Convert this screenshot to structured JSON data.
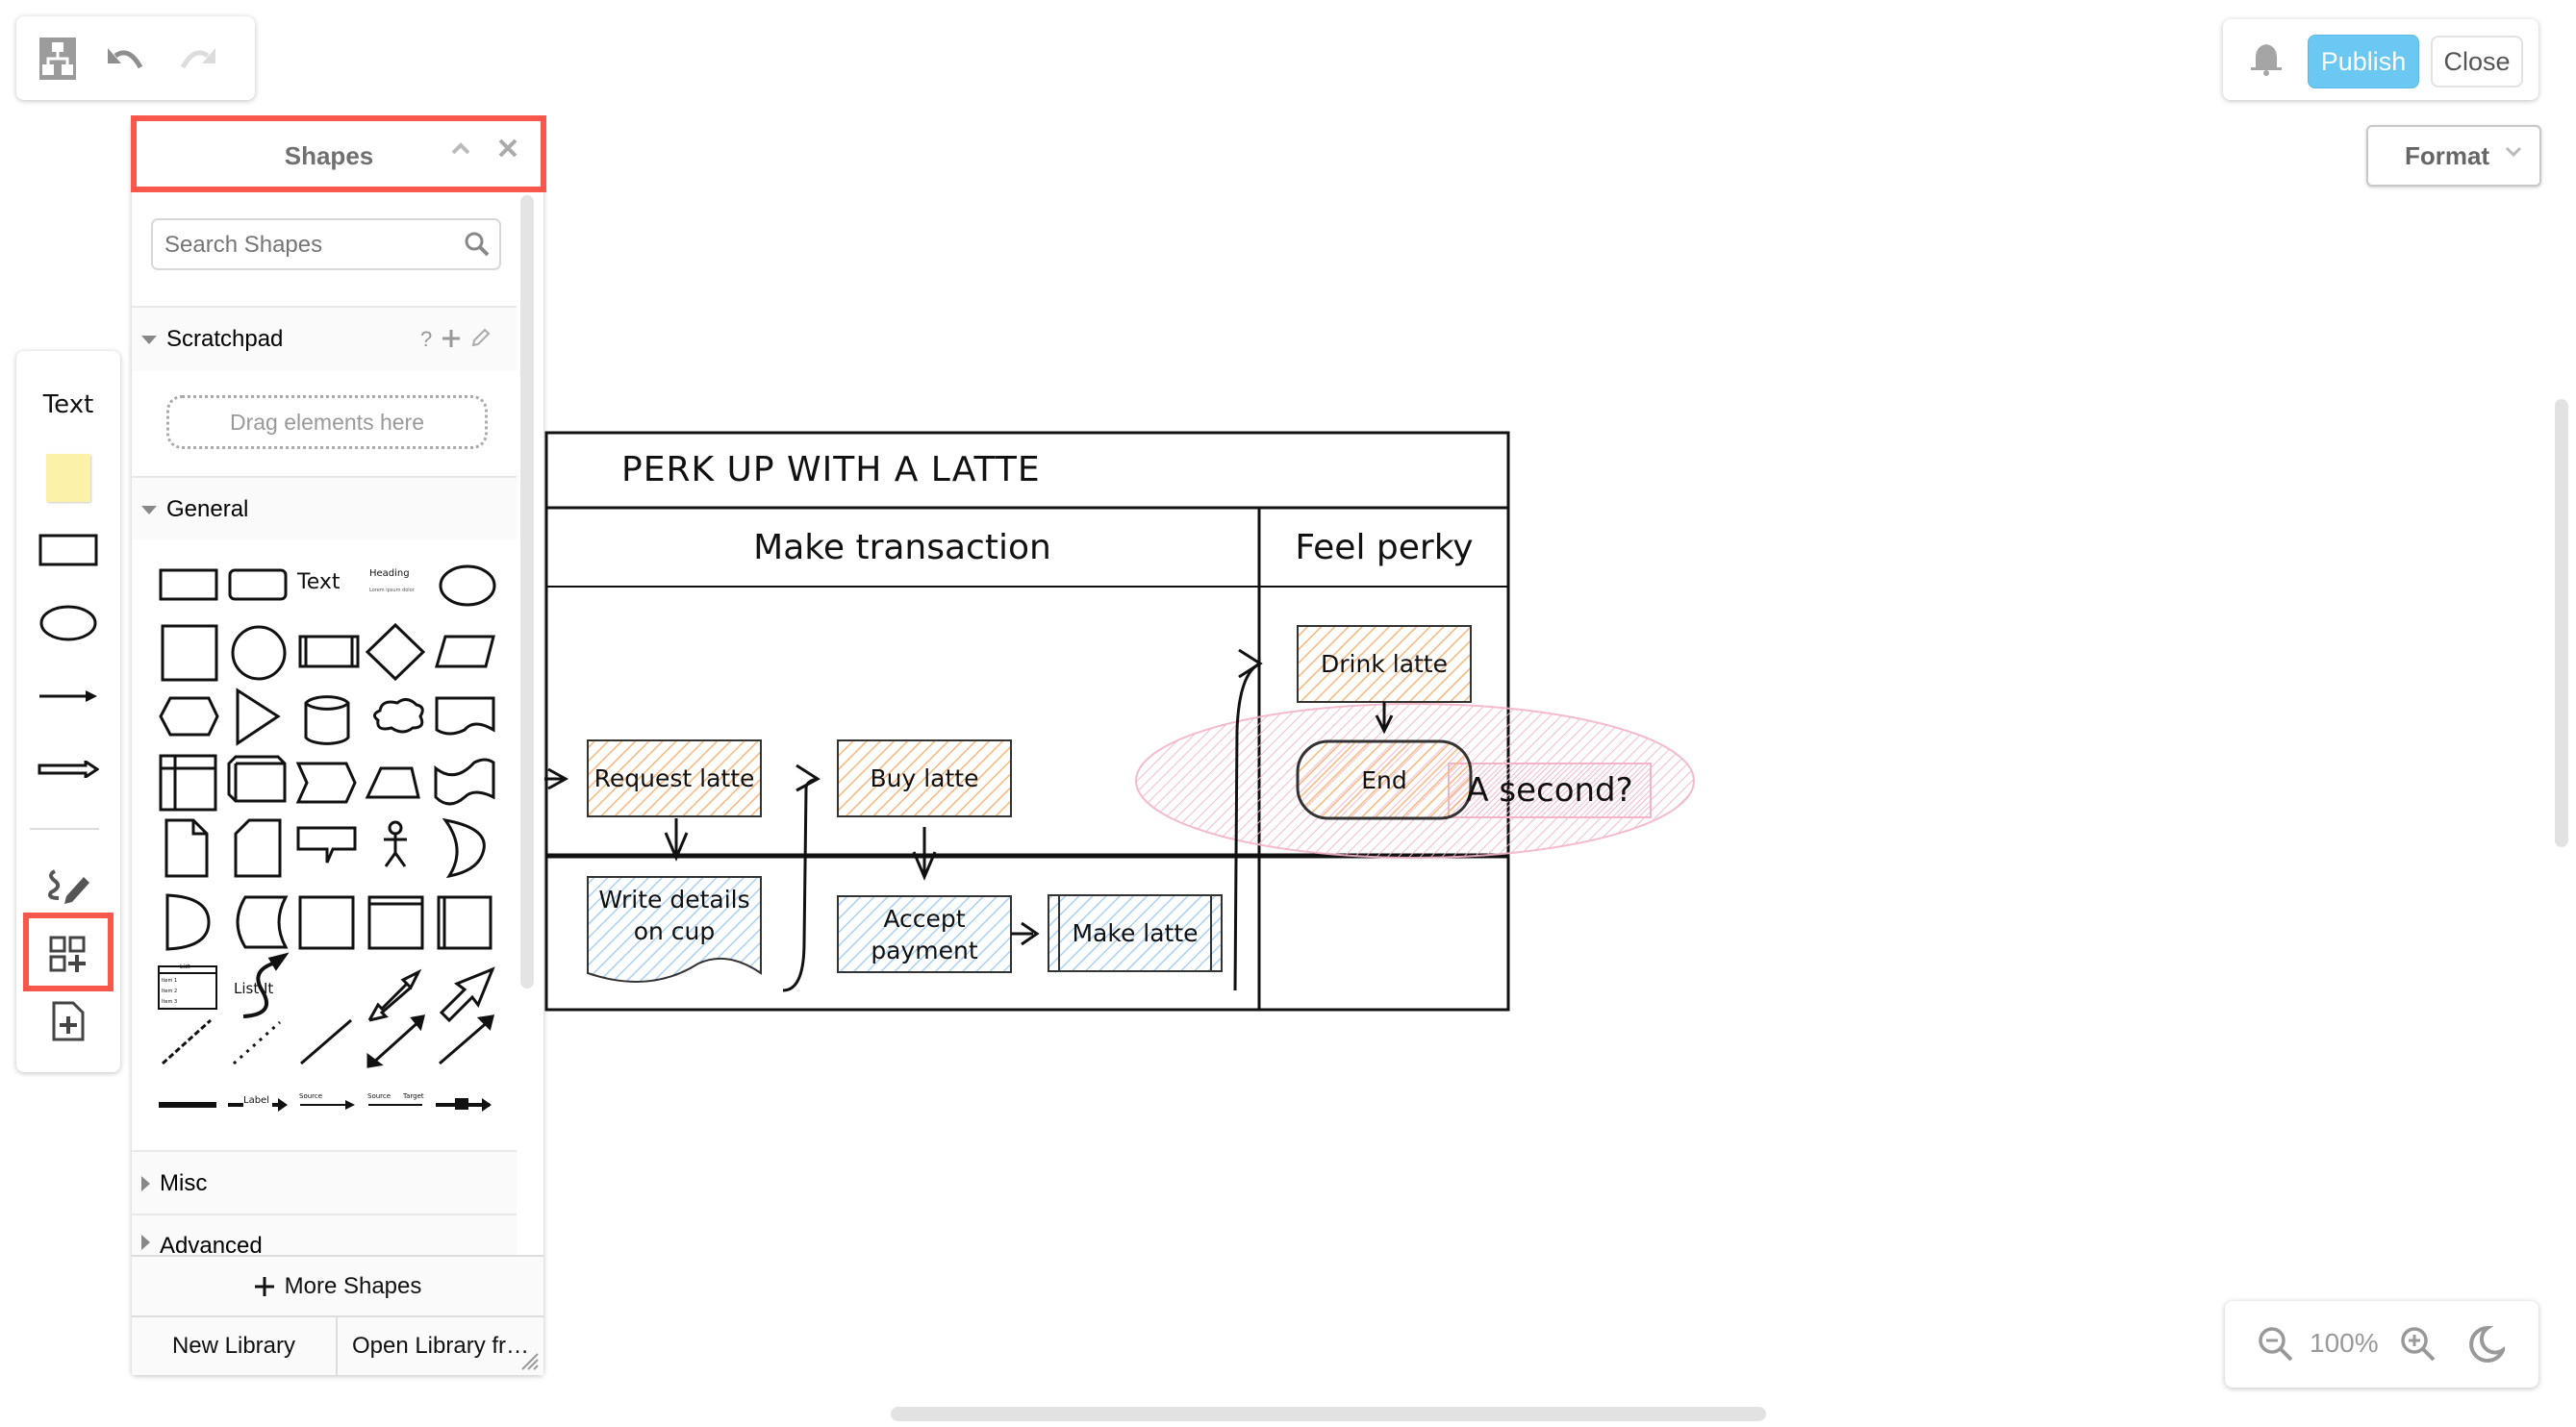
{
  "toolbar": {
    "icons": [
      "diagram-app-icon",
      "undo-icon",
      "redo-icon"
    ]
  },
  "header_right": {
    "bell_icon": "bell-icon",
    "publish_label": "Publish",
    "close_label": "Close",
    "accent_color": "#6ac8f2"
  },
  "format": {
    "label": "Format"
  },
  "left_tools": {
    "text_label": "Text",
    "items": [
      "text",
      "sticky-note",
      "rectangle",
      "ellipse",
      "arrow",
      "double-arrow",
      "freehand",
      "shapes",
      "insert-page"
    ]
  },
  "shapes_panel": {
    "title": "Shapes",
    "search_placeholder": "Search Shapes",
    "scratchpad": {
      "label": "Scratchpad",
      "help": "?",
      "drop_hint": "Drag elements here"
    },
    "general": {
      "label": "General",
      "text_shape": "Text",
      "heading_shape": "Heading",
      "heading_sub": "Lorem ipsum dolor",
      "list_title": "List",
      "list_items": [
        "Item 1",
        "Item 2",
        "Item 3"
      ],
      "list_it": "List It",
      "label_edge": "Label",
      "source": "Source",
      "target": "Target"
    },
    "sections": [
      {
        "label": "Misc"
      },
      {
        "label": "Advanced"
      }
    ],
    "more_shapes": "More Shapes",
    "new_library": "New Library",
    "open_library": "Open Library fr…"
  },
  "diagram": {
    "title": "PERK UP WITH A LATTE",
    "lanes": [
      "Make transaction",
      "Feel perky"
    ],
    "nodes": {
      "request": "Request latte",
      "buy": "Buy latte",
      "write": "Write details on cup",
      "accept": "Accept payment",
      "make": "Make latte",
      "drink": "Drink latte",
      "end": "End",
      "second": "A second?"
    },
    "colors": {
      "orange": "#f9b77c",
      "blue": "#a9d1f7",
      "pink": "#f3a6bf"
    }
  },
  "zoom": {
    "level": "100%"
  }
}
